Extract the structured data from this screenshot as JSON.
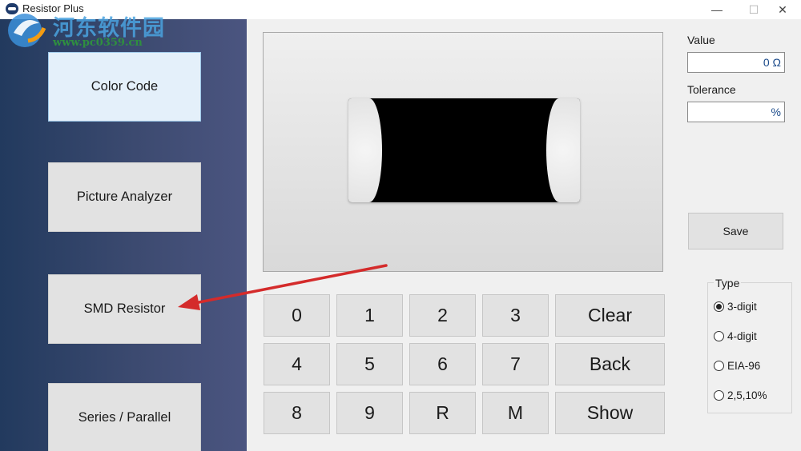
{
  "window": {
    "title": "Resistor Plus",
    "min_glyph": "—",
    "max_glyph": "☐",
    "close_glyph": "✕"
  },
  "watermark": {
    "text": "河东软件园",
    "url": "www.pc0359.cn"
  },
  "sidebar": {
    "items": [
      {
        "label": "Color Code",
        "active": true
      },
      {
        "label": "Picture Analyzer",
        "active": false
      },
      {
        "label": "SMD Resistor",
        "active": false
      },
      {
        "label": "Series / Parallel",
        "active": false
      }
    ]
  },
  "keypad": {
    "keys": [
      "0",
      "1",
      "2",
      "3",
      "Clear",
      "4",
      "5",
      "6",
      "7",
      "Back",
      "8",
      "9",
      "R",
      "M",
      "Show"
    ]
  },
  "panel": {
    "value_label": "Value",
    "value_text": "0 Ω",
    "tolerance_label": "Tolerance",
    "tolerance_text": "%",
    "save_label": "Save",
    "type_label": "Type",
    "type_options": [
      "3-digit",
      "4-digit",
      "EIA-96",
      "2,5,10%"
    ],
    "type_selected": "3-digit"
  },
  "colors": {
    "annotation_arrow": "#d42b2b",
    "resistor_body": "#000000"
  }
}
